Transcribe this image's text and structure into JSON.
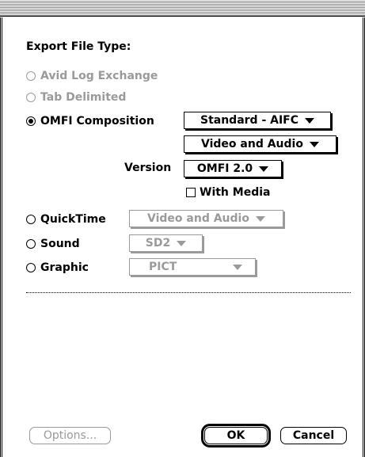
{
  "dialog": {
    "heading": "Export File Type:",
    "options": {
      "avid_log": "Avid Log Exchange",
      "tab_delimited": "Tab Delimited",
      "omfi": "OMFI Composition",
      "quicktime": "QuickTime",
      "sound": "Sound",
      "graphic": "Graphic"
    },
    "selected": "OMFI Composition",
    "omfi": {
      "audio_format": "Standard - AIFC",
      "content": "Video and Audio",
      "version_label": "Version",
      "version": "OMFI 2.0",
      "with_media_label": "With Media",
      "with_media_checked": false
    },
    "quicktime_content": "Video and Audio",
    "sound_format": "SD2",
    "graphic_format": "PICT",
    "buttons": {
      "options": "Options...",
      "ok": "OK",
      "cancel": "Cancel"
    }
  }
}
